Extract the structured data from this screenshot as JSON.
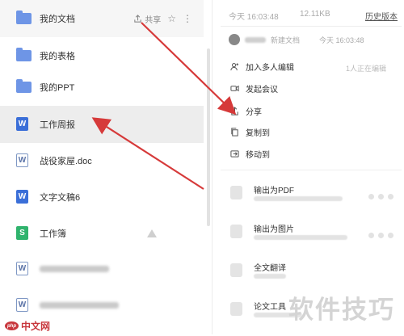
{
  "file_list": {
    "items": [
      {
        "name": "我的文档",
        "type": "folder"
      },
      {
        "name": "我的表格",
        "type": "folder"
      },
      {
        "name": "我的PPT",
        "type": "folder"
      },
      {
        "name": "工作周报",
        "type": "doc-blue",
        "icon_letter": "W"
      },
      {
        "name": "战役家屋.doc",
        "type": "doc-outline",
        "icon_letter": "W"
      },
      {
        "name": "文字文稿6",
        "type": "doc-blue",
        "icon_letter": "W"
      },
      {
        "name": "工作簿",
        "type": "sheet-green",
        "icon_letter": "S"
      },
      {
        "name": "",
        "type": "doc-outline",
        "icon_letter": "W"
      },
      {
        "name": "",
        "type": "doc-outline",
        "icon_letter": "W"
      }
    ],
    "share_label": "共享"
  },
  "detail_panel": {
    "modified_time": "今天 16:03:48",
    "file_size": "12.11KB",
    "history_link": "历史版本",
    "recent_user": "",
    "recent_action": "新建文档",
    "recent_time": "今天 16:03:48",
    "actions": [
      {
        "label": "加入多人编辑",
        "icon": "add-user-icon",
        "hint": "1人正在编辑"
      },
      {
        "label": "发起会议",
        "icon": "video-icon",
        "hint": ""
      },
      {
        "label": "分享",
        "icon": "share-icon",
        "hint": ""
      },
      {
        "label": "复制到",
        "icon": "copy-icon",
        "hint": ""
      },
      {
        "label": "移动到",
        "icon": "move-icon",
        "hint": ""
      }
    ],
    "features": [
      {
        "title": "输出为PDF",
        "icon": "pdf-icon"
      },
      {
        "title": "输出为图片",
        "icon": "image-icon"
      },
      {
        "title": "全文翻译",
        "icon": "translate-icon"
      },
      {
        "title": "论文工具",
        "icon": "paper-icon"
      }
    ]
  },
  "watermark": {
    "text": "软件技巧"
  },
  "badge": {
    "logo_text": "php",
    "text": "中文网"
  }
}
